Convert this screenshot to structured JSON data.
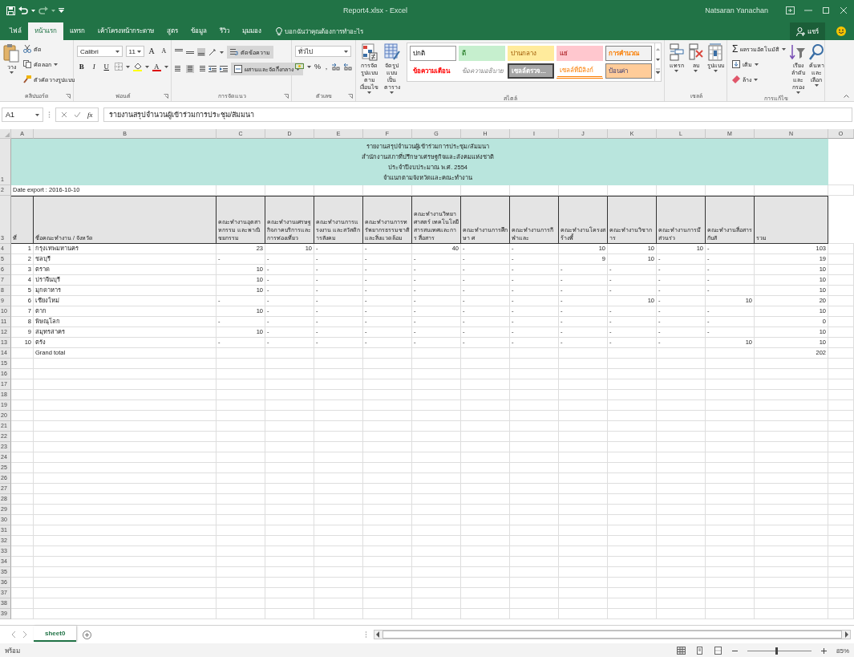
{
  "window": {
    "title": "Report4.xlsx - Excel",
    "user": "Natsaran Yanachan",
    "share": "แชร์"
  },
  "tabs": [
    {
      "label": "ไฟล์",
      "selected": false
    },
    {
      "label": "หน้าแรก",
      "selected": true
    },
    {
      "label": "แทรก",
      "selected": false
    },
    {
      "label": "เค้าโครงหน้ากระดาษ",
      "selected": false
    },
    {
      "label": "สูตร",
      "selected": false
    },
    {
      "label": "ข้อมูล",
      "selected": false
    },
    {
      "label": "รีวิว",
      "selected": false
    },
    {
      "label": "มุมมอง",
      "selected": false
    }
  ],
  "tell_me": "บอกฉันว่าคุณต้องการทำอะไร",
  "ribbon": {
    "clipboard": {
      "paste": "วาง",
      "cut": "ตัด",
      "copy": "คัดลอก",
      "format_painter": "ตัวคัดวางรูปแบบ",
      "label": "คลิปบอร์ด"
    },
    "font": {
      "name": "Calibri",
      "size": "11",
      "grow": "A",
      "shrink": "A",
      "styles": [
        "B",
        "I",
        "U"
      ],
      "color_letter": "A",
      "label": "ฟอนต์"
    },
    "alignment": {
      "wrap": "ตัดข้อความ",
      "merge": "ผสานและจัดกึ่งกลาง",
      "label": "การจัดแนว"
    },
    "number": {
      "format": "ทั่วไป",
      "symbols": [
        "%",
        ","
      ],
      "label": "ตัวเลข"
    },
    "styles": {
      "conditional": "การจัดรูปแบบ ตามเงื่อนไข",
      "as_table": "จัดรูปแบบ เป็นตาราง",
      "label": "สไตล์",
      "cells": [
        {
          "label": "ปกติ",
          "kind": "normal"
        },
        {
          "label": "ดี",
          "kind": "good"
        },
        {
          "label": "ปานกลาง",
          "kind": "neutral"
        },
        {
          "label": "แย่",
          "kind": "bad"
        },
        {
          "label": "การคำนวณ",
          "kind": "calculation"
        },
        {
          "label": "ข้อความเตือน",
          "kind": "warning"
        },
        {
          "label": "ข้อความอธิบาย",
          "kind": "explanatory"
        },
        {
          "label": "เซลล์ตรวจ...",
          "kind": "check"
        },
        {
          "label": "เซลล์ที่มีลิงก์",
          "kind": "linked"
        },
        {
          "label": "ป้อนค่า",
          "kind": "input"
        }
      ]
    },
    "cells": {
      "insert": "แทรก",
      "delete": "ลบ",
      "format": "รูปแบบ",
      "label": "เซลล์"
    },
    "editing": {
      "autosum_symbol": "Σ",
      "autosum": "ผลรวมอัตโนมัติ",
      "fill": "เติม",
      "clear": "ล้าง",
      "sort": "เรียงลำดับ และกรอง",
      "find": "ค้นหาและ เลือก",
      "label": "การแก้ไข"
    }
  },
  "formula_bar": {
    "name_box": "A1",
    "fx": "fx",
    "formula": "รายงานสรุปจำนวนผู้เข้าร่วมการประชุม/สัมมนา"
  },
  "sheet": {
    "columns": [
      "A",
      "B",
      "C",
      "D",
      "E",
      "F",
      "G",
      "H",
      "I",
      "J",
      "K",
      "L",
      "M",
      "N",
      "O"
    ],
    "row_numbers": [
      "1",
      "2",
      "3",
      "4",
      "5",
      "6",
      "7",
      "8",
      "9",
      "10",
      "11",
      "12",
      "13",
      "14",
      "15",
      "16",
      "17",
      "18",
      "19",
      "20",
      "21",
      "22",
      "23",
      "24",
      "25",
      "26",
      "27",
      "28",
      "29",
      "30",
      "31",
      "32",
      "33",
      "34",
      "35",
      "36",
      "37",
      "38",
      "39"
    ],
    "title_lines": [
      "รายงานสรุปจำนวนผู้เข้าร่วมการประชุม/สัมมนา",
      "สำนักงานสภาที่ปรึกษาเศรษฐกิจและสังคมแห่งชาติ",
      "ประจำปีงบประมาณ พ.ศ. 2554",
      "จำแนกตามจังหวัดและคณะทำงาน"
    ],
    "date_export": "Date export : 2016-10-10",
    "headers": [
      "ที่",
      "ชื่อคณะทำงาน / จังหวัด",
      "คณะทำงานอุตสาหกรรม และพาณิชยกรรม",
      "คณะทำงานเศรษฐกิจภาคบริการและการท่องเที่ยว",
      "คณะทำงานการแรงงาน และสวัสดิการสังคม",
      "คณะทำงานการทรัพยากรธรรมชาติและสิ่งแวดล้อม",
      "คณะทำงานวิทยาศาสตร์ เทคโนโลยี สารสนเทศและการ สื่อสาร",
      "คณะทำงานการศึกษา ศ",
      "คณะทำงานการกีฬาและ",
      "คณะทำงานโครงสร้างพื้",
      "คณะทำงานวิชาการ",
      "คณะทำงานการมีส่วนร่ว",
      "คณะทำงานสื่อสารกับสั",
      "รวม"
    ],
    "rows": [
      {
        "no": "1",
        "name": "กรุงเทพมหานคร",
        "values": [
          "23",
          "10",
          "-",
          "-",
          "40",
          "-",
          "-",
          "10",
          "10",
          "10",
          "-"
        ],
        "total": "103"
      },
      {
        "no": "2",
        "name": "ชลบุรี",
        "values": [
          "-",
          "-",
          "-",
          "-",
          "-",
          "-",
          "-",
          "9",
          "10",
          "-",
          "-"
        ],
        "total": "19"
      },
      {
        "no": "3",
        "name": "ตราด",
        "values": [
          "10",
          "-",
          "-",
          "-",
          "-",
          "-",
          "-",
          "-",
          "-",
          "-",
          "-"
        ],
        "total": "10"
      },
      {
        "no": "4",
        "name": "ปราจีนบุรี",
        "values": [
          "10",
          "-",
          "-",
          "-",
          "-",
          "-",
          "-",
          "-",
          "-",
          "-",
          "-"
        ],
        "total": "10"
      },
      {
        "no": "5",
        "name": "มุกดาหาร",
        "values": [
          "10",
          "-",
          "-",
          "-",
          "-",
          "-",
          "-",
          "-",
          "-",
          "-",
          "-"
        ],
        "total": "10"
      },
      {
        "no": "6",
        "name": "เชียงใหม่",
        "values": [
          "-",
          "-",
          "-",
          "-",
          "-",
          "-",
          "-",
          "-",
          "10",
          "-",
          "10"
        ],
        "total": "20"
      },
      {
        "no": "7",
        "name": "ตาก",
        "values": [
          "10",
          "-",
          "-",
          "-",
          "-",
          "-",
          "-",
          "-",
          "-",
          "-",
          "-"
        ],
        "total": "10"
      },
      {
        "no": "8",
        "name": "พิษณุโลก",
        "values": [
          "-",
          "-",
          "-",
          "-",
          "-",
          "-",
          "-",
          "-",
          "-",
          "-",
          "-"
        ],
        "total": "0"
      },
      {
        "no": "9",
        "name": "สมุทรสาคร",
        "values": [
          "10",
          "-",
          "-",
          "-",
          "-",
          "-",
          "-",
          "-",
          "-",
          "-",
          "-"
        ],
        "total": "10"
      },
      {
        "no": "10",
        "name": "ตรัง",
        "values": [
          "-",
          "-",
          "-",
          "-",
          "-",
          "-",
          "-",
          "-",
          "-",
          "-",
          "10"
        ],
        "total": "10"
      }
    ],
    "grand_total": {
      "label": "Grand total",
      "total": "202"
    }
  },
  "sheet_tabs": [
    {
      "label": "sheet0",
      "selected": true
    }
  ],
  "status_bar": {
    "text": "พร้อม",
    "zoom": "85%",
    "zoom_slider": {
      "level": 0.45
    }
  }
}
